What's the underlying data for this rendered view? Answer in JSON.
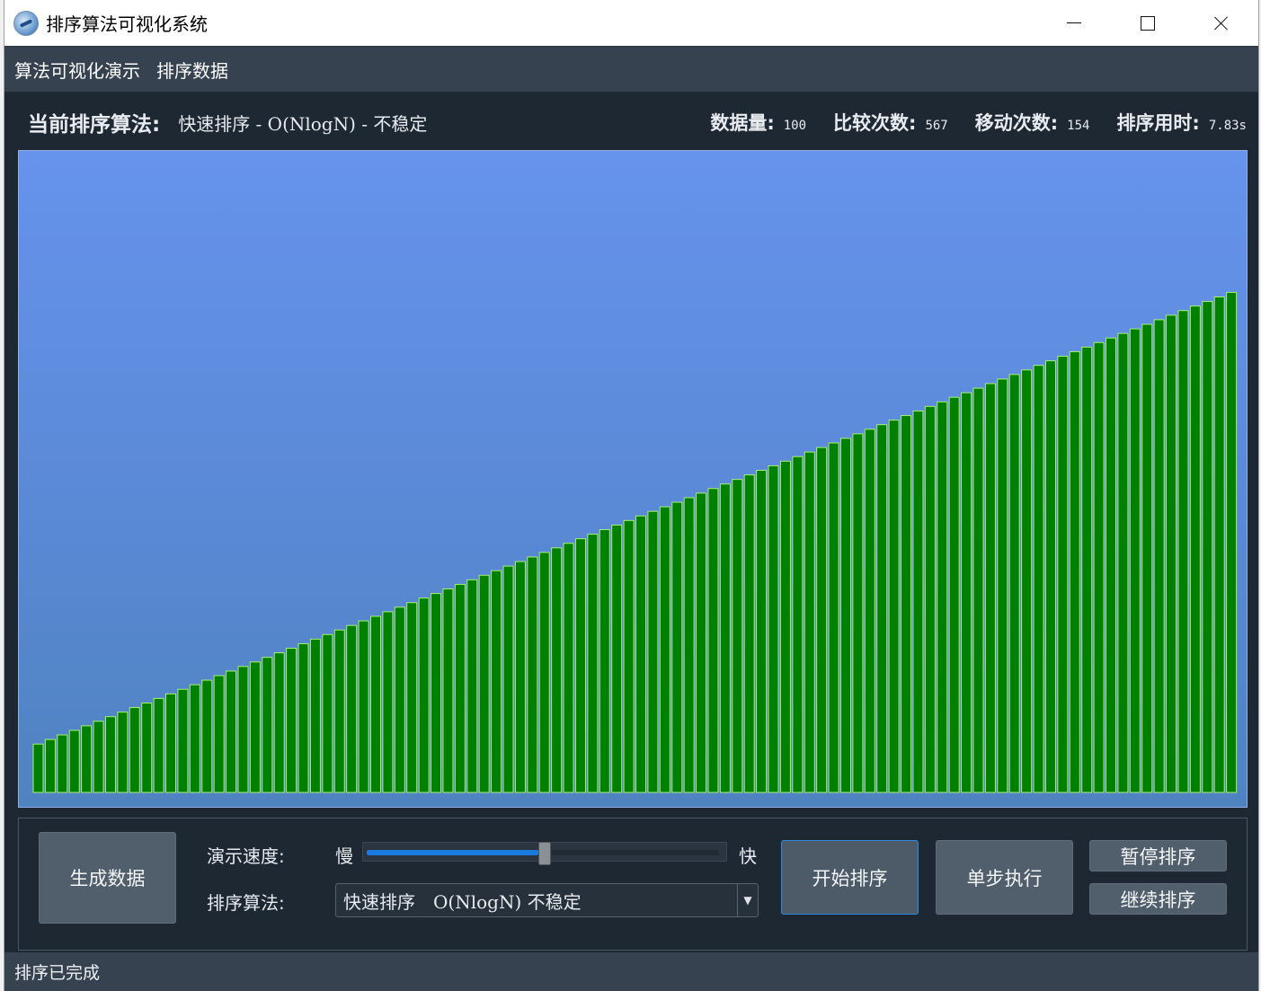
{
  "window": {
    "title": "排序算法可视化系统",
    "icon": "app-logo-icon"
  },
  "menu": {
    "items": [
      "算法可视化演示",
      "排序数据"
    ]
  },
  "info": {
    "current_label": "当前排序算法:",
    "current_value": "快速排序 - O(NlogN) - 不稳定",
    "count_label": "数据量:",
    "count_value": "100",
    "compare_label": "比较次数:",
    "compare_value": "567",
    "move_label": "移动次数:",
    "move_value": "154",
    "time_label": "排序用时:",
    "time_value": "7.83s"
  },
  "chart_data": {
    "type": "bar",
    "title": "",
    "xlabel": "",
    "ylabel": "",
    "bar_color": "#008000",
    "bar_border": "#a8f070",
    "background_top": "#6693ec",
    "background_bottom": "#4f83c0",
    "values": [
      1,
      2,
      3,
      4,
      5,
      6,
      7,
      8,
      9,
      10,
      11,
      12,
      13,
      14,
      15,
      16,
      17,
      18,
      19,
      20,
      21,
      22,
      23,
      24,
      25,
      26,
      27,
      28,
      29,
      30,
      31,
      32,
      33,
      34,
      35,
      36,
      37,
      38,
      39,
      40,
      41,
      42,
      43,
      44,
      45,
      46,
      47,
      48,
      49,
      50,
      51,
      52,
      53,
      54,
      55,
      56,
      57,
      58,
      59,
      60,
      61,
      62,
      63,
      64,
      65,
      66,
      67,
      68,
      69,
      70,
      71,
      72,
      73,
      74,
      75,
      76,
      77,
      78,
      79,
      80,
      81,
      82,
      83,
      84,
      85,
      86,
      87,
      88,
      89,
      90,
      91,
      92,
      93,
      94,
      95,
      96,
      97,
      98,
      99,
      100
    ],
    "ylim": [
      -9.6,
      131
    ]
  },
  "controls": {
    "generate_button": "生成数据",
    "speed_label": "演示速度:",
    "slow_label": "慢",
    "fast_label": "快",
    "speed_value": 0.5,
    "algorithm_label": "排序算法:",
    "algorithm_selected": "快速排序　O(NlogN) 不稳定",
    "start_button": "开始排序",
    "step_button": "单步执行",
    "pause_button": "暂停排序",
    "resume_button": "继续排序"
  },
  "status": {
    "text": "排序已完成"
  }
}
